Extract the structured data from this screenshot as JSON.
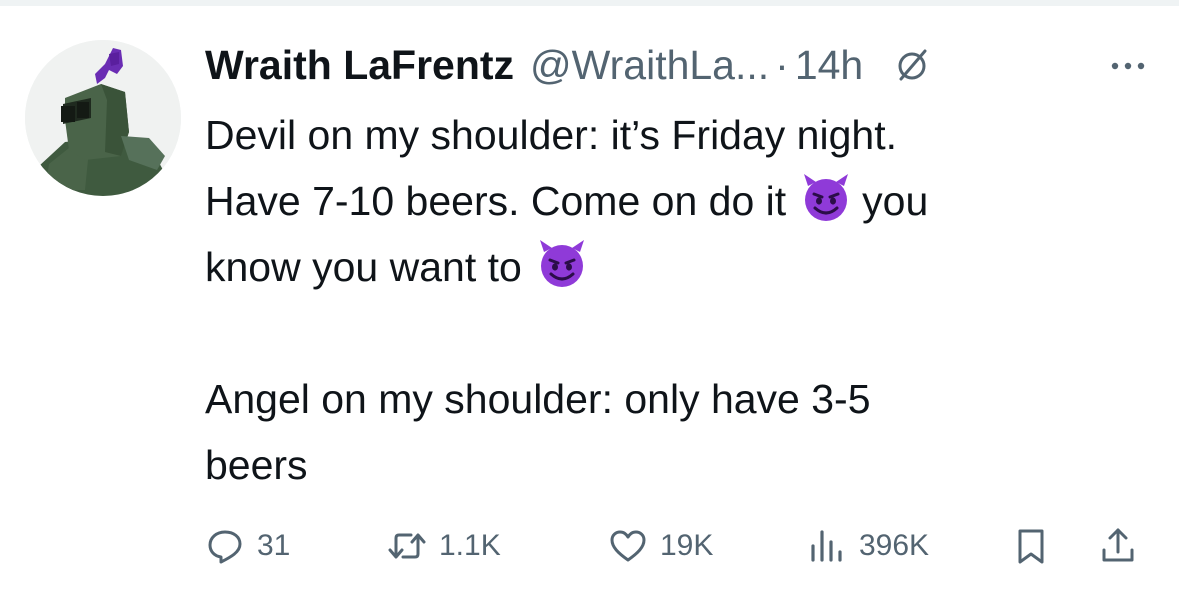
{
  "tweet": {
    "author_name": "Wraith LaFrentz",
    "author_handle": "@WraithLa...",
    "separator": "·",
    "time": "14h",
    "lines": [
      "Devil on my shoulder: it’s Friday night.",
      "Have 7-10 beers. Come on do it",
      "you",
      "know you want to",
      "Angel on my shoulder: only have 3-5",
      "beers"
    ],
    "emoji": "smiling-imp-emoji"
  },
  "actions": {
    "replies": "31",
    "reposts": "1.1K",
    "likes": "19K",
    "views": "396K"
  },
  "icons": [
    "verified-slash-icon",
    "more-icon",
    "reply-icon",
    "repost-icon",
    "like-icon",
    "views-icon",
    "bookmark-icon",
    "share-icon"
  ],
  "colors": {
    "text": "#0f1419",
    "secondary": "#536471",
    "emoji_purple": "#8f3ad8",
    "avatar_armor": "#4a6449",
    "avatar_plume": "#6a2db3"
  }
}
